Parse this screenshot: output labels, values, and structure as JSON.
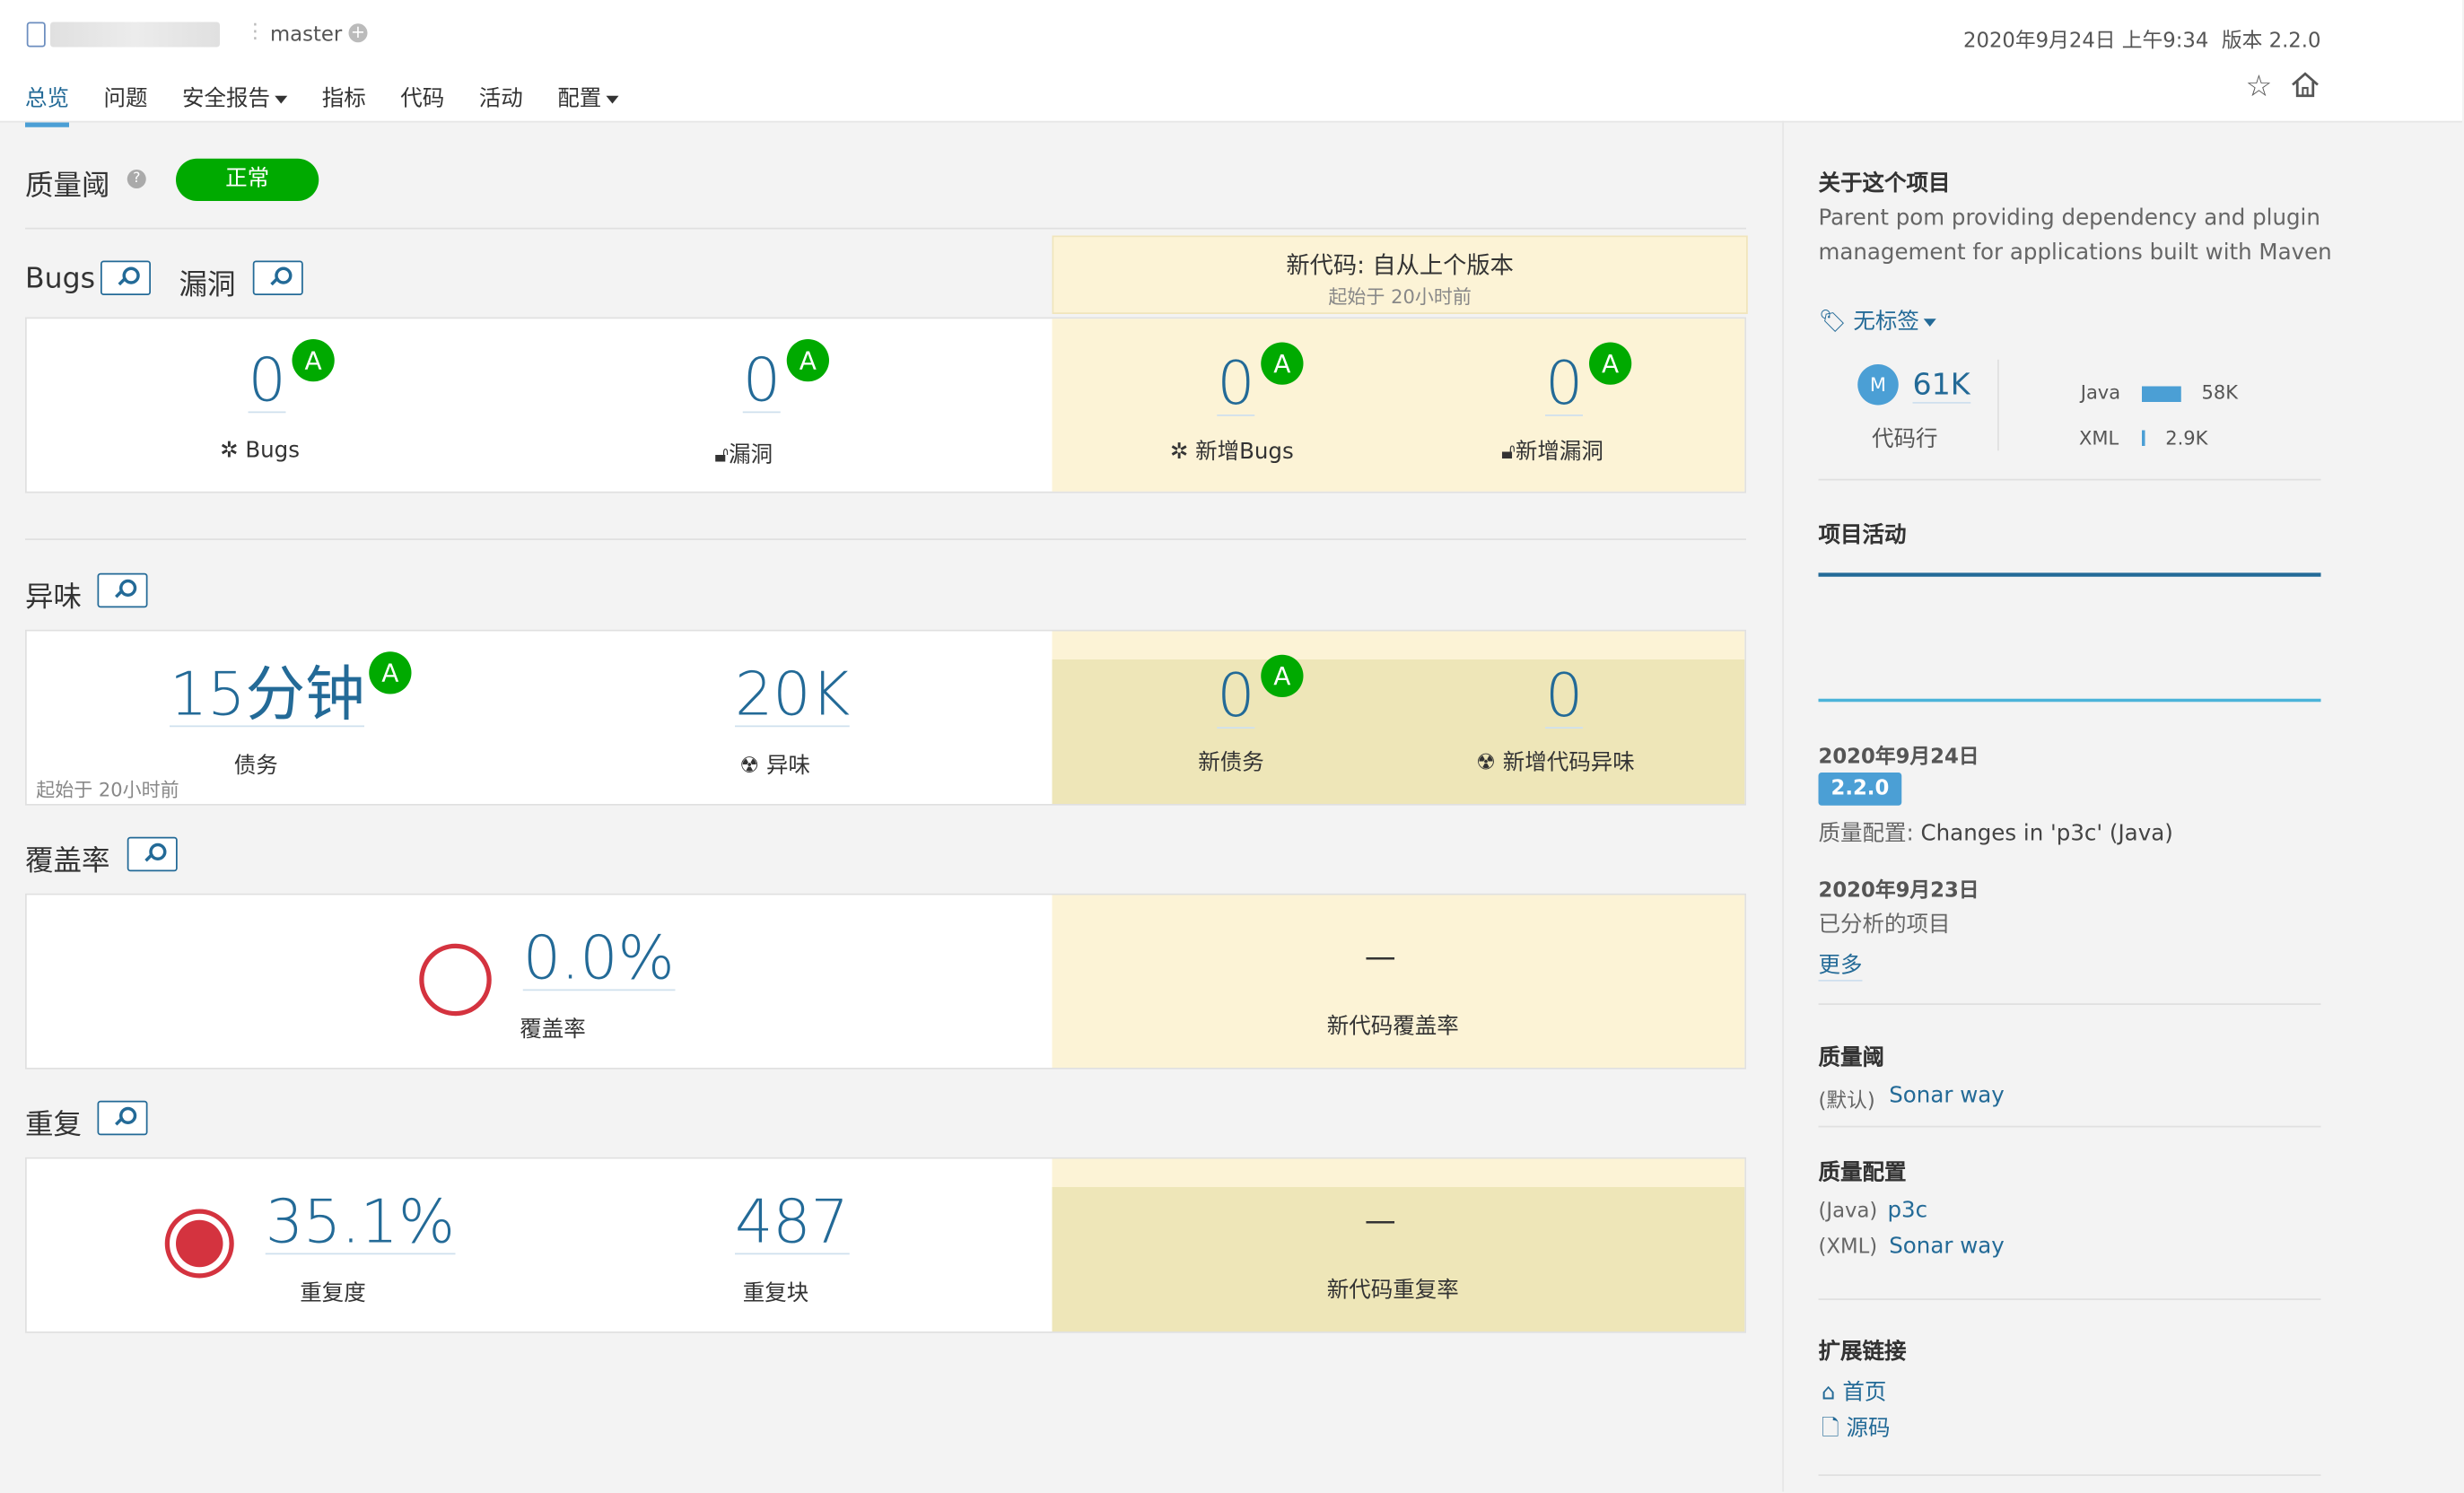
{
  "header": {
    "branch": "master",
    "analysis_date": "2020年9月24日 上午9:34",
    "version_label": "版本 2.2.0"
  },
  "nav": {
    "tabs": [
      {
        "label": "总览"
      },
      {
        "label": "问题"
      },
      {
        "label": "安全报告"
      },
      {
        "label": "指标"
      },
      {
        "label": "代码"
      },
      {
        "label": "活动"
      },
      {
        "label": "配置"
      }
    ]
  },
  "quality_gate": {
    "title": "质量阈",
    "status": "正常"
  },
  "new_code": {
    "title": "新代码: 自从上个版本",
    "since": "起始于 20小时前"
  },
  "bugs_section": {
    "title_bugs": "Bugs",
    "title_vuln": "漏洞",
    "bugs": {
      "value": "0",
      "rating": "A",
      "label": "Bugs"
    },
    "vulns": {
      "value": "0",
      "rating": "A",
      "label": "漏洞"
    },
    "new_bugs": {
      "value": "0",
      "rating": "A",
      "label": "新增Bugs"
    },
    "new_vulns": {
      "value": "0",
      "rating": "A",
      "label": "新增漏洞"
    }
  },
  "smells_section": {
    "title": "异味",
    "debt": {
      "value": "15分钟",
      "rating": "A",
      "label": "债务"
    },
    "smells": {
      "value": "20K",
      "label": "异味"
    },
    "new_debt": {
      "value": "0",
      "rating": "A",
      "label": "新债务"
    },
    "new_smells": {
      "value": "0",
      "label": "新增代码异味"
    },
    "note": "起始于 20小时前"
  },
  "coverage_section": {
    "title": "覆盖率",
    "coverage": {
      "value": "0.0%",
      "label": "覆盖率"
    },
    "new_coverage": {
      "value": "—",
      "label": "新代码覆盖率"
    }
  },
  "dup_section": {
    "title": "重复",
    "density": {
      "value": "35.1%",
      "label": "重复度"
    },
    "blocks": {
      "value": "487",
      "label": "重复块"
    },
    "new_dup": {
      "value": "—",
      "label": "新代码重复率"
    }
  },
  "sidebar": {
    "about_title": "关于这个项目",
    "description_line1": "Parent pom providing dependency and plugin",
    "description_line2": "management for applications built with Maven",
    "tags": "无标签",
    "loc_avatar": "M",
    "loc_value": "61K",
    "loc_label": "代码行",
    "lang_java": "Java",
    "lang_java_value": "58K",
    "lang_java_share": 0.95,
    "lang_xml": "XML",
    "lang_xml_value": "2.9K",
    "lang_xml_share": 0.05,
    "activity_title": "项目活动",
    "event1_date": "2020年9月24日",
    "event1_version": "2.2.0",
    "event1_prefix": "质量配置: ",
    "event1_text": "Changes in 'p3c' (Java)",
    "event2_date": "2020年9月23日",
    "event2_text": "已分析的项目",
    "more": "更多",
    "qg_title": "质量阈",
    "qg_default": "(默认)",
    "qg_link": "Sonar way",
    "qp_title": "质量配置",
    "qp_java": "(Java)",
    "qp_java_link": "p3c",
    "qp_xml": "(XML)",
    "qp_xml_link": "Sonar way",
    "links_title": "扩展链接",
    "link_home": "首页",
    "link_source": "源码"
  }
}
